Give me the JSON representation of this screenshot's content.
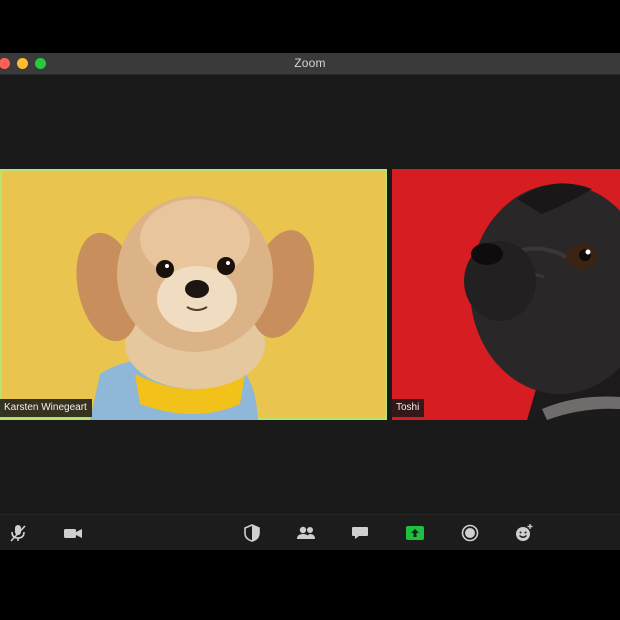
{
  "window": {
    "title": "Zoom"
  },
  "participants": [
    {
      "name": "Karsten Winegeart",
      "active_speaker": true,
      "background_color": "#e9c550",
      "highlight_color": "#b9e36f"
    },
    {
      "name": "Toshi",
      "active_speaker": false,
      "background_color": "#d61d22"
    }
  ],
  "toolbar": {
    "items": [
      {
        "icon": "microphone-muted-icon"
      },
      {
        "icon": "video-camera-icon"
      },
      {
        "icon": "security-shield-icon"
      },
      {
        "icon": "participants-icon"
      },
      {
        "icon": "chat-bubble-icon"
      },
      {
        "icon": "share-screen-icon",
        "accent": "#1fbf3f"
      },
      {
        "icon": "record-icon"
      },
      {
        "icon": "reactions-icon"
      }
    ]
  }
}
